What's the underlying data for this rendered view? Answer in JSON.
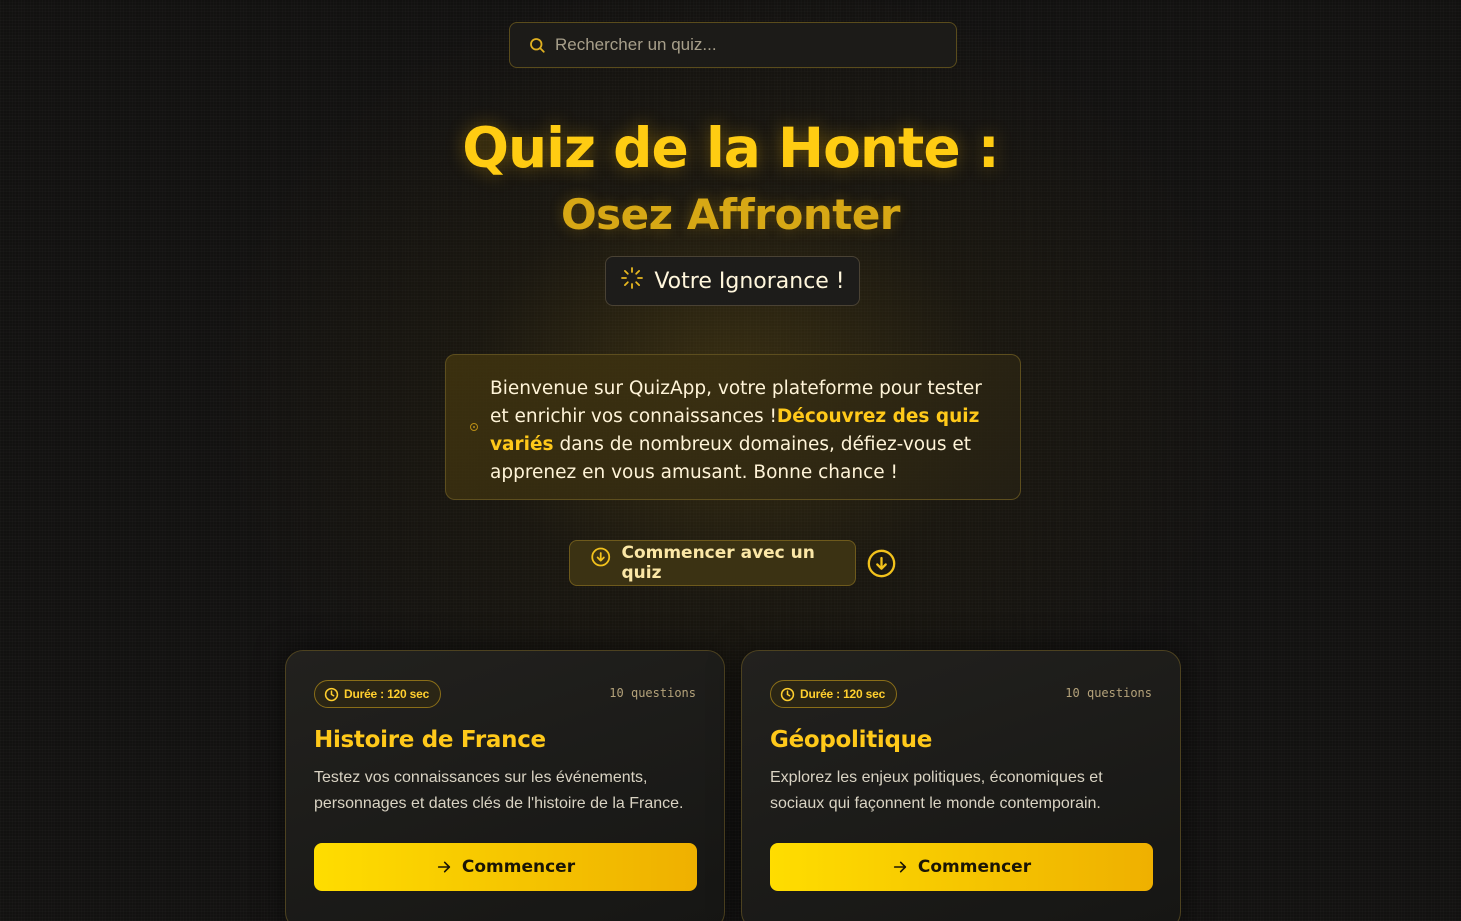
{
  "search": {
    "placeholder": "Rechercher un quiz..."
  },
  "hero": {
    "title_line1": "Quiz de la Honte :",
    "title_line2": "Osez Affronter",
    "badge": "Votre Ignorance !"
  },
  "intro": {
    "text_before": "Bienvenue sur QuizApp, votre plateforme pour tester et enrichir vos connaissances !",
    "highlight": "Découvrez des quiz variés",
    "text_after": " dans de nombreux domaines, défiez-vous et apprenez en vous amusant. Bonne chance !"
  },
  "cta": {
    "label": "Commencer avec un quiz"
  },
  "quizzes": [
    {
      "duration": "Durée : 120 sec",
      "questions": "10 questions",
      "title": "Histoire de France",
      "description": "Testez vos connaissances sur les événements, personnages et dates clés de l'histoire de la France.",
      "button": "Commencer"
    },
    {
      "duration": "Durée : 120 sec",
      "questions": "10 questions",
      "title": "Géopolitique",
      "description": "Explorez les enjeux politiques, économiques et sociaux qui façonnent le monde contemporain.",
      "button": "Commencer"
    }
  ],
  "colors": {
    "accent": "#ffcc12",
    "background": "#121110",
    "button_gradient_start": "#ffdd00",
    "button_gradient_end": "#efb000"
  },
  "icons": {
    "search": "search-icon",
    "badge": "spinner-icon",
    "cta": "arrow-down-circle-icon",
    "duration": "clock-icon",
    "start": "arrow-right-icon"
  }
}
